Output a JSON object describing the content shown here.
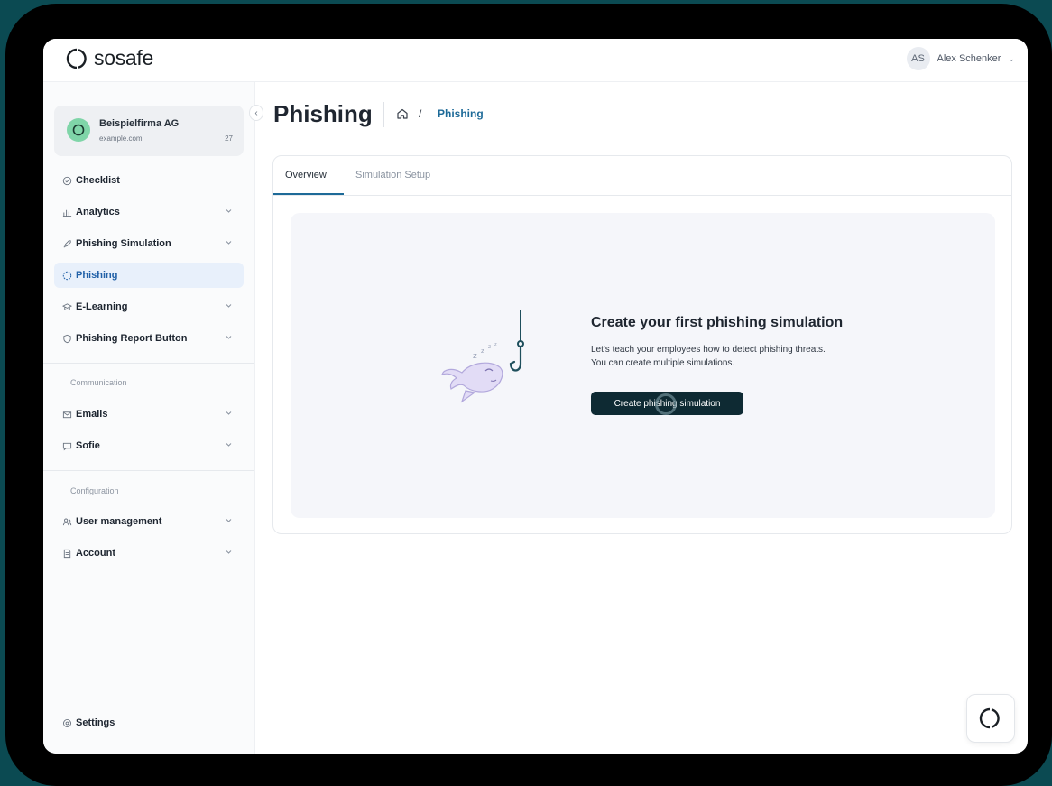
{
  "brand": {
    "name": "sosafe"
  },
  "user": {
    "initials": "AS",
    "name": "Alex Schenker"
  },
  "org": {
    "name": "Beispielfirma AG",
    "domain": "example.com",
    "count": "27"
  },
  "sidebar": {
    "items": [
      {
        "label": "Checklist",
        "icon": "check-circle-icon"
      },
      {
        "label": "Analytics",
        "icon": "bar-chart-icon"
      },
      {
        "label": "Phishing Simulation",
        "icon": "rocket-icon"
      },
      {
        "label": "Phishing",
        "icon": "hook-icon"
      },
      {
        "label": "E-Learning",
        "icon": "graduation-cap-icon"
      },
      {
        "label": "Phishing Report Button",
        "icon": "shield-icon"
      }
    ],
    "communication_label": "Communication",
    "communication": [
      {
        "label": "Emails",
        "icon": "mail-icon"
      },
      {
        "label": "Sofie",
        "icon": "chat-icon"
      }
    ],
    "configuration_label": "Configuration",
    "configuration": [
      {
        "label": "User management",
        "icon": "users-icon"
      },
      {
        "label": "Account",
        "icon": "document-icon"
      }
    ],
    "settings_label": "Settings"
  },
  "page": {
    "title": "Phishing",
    "breadcrumb_separator": "/",
    "breadcrumb_current": "Phishing"
  },
  "tabs": [
    {
      "label": "Overview",
      "active": true
    },
    {
      "label": "Simulation Setup",
      "active": false
    }
  ],
  "empty_state": {
    "title": "Create your first phishing simulation",
    "desc_line1": "Let's teach your employees how to detect phishing threats.",
    "desc_line2": "You can create multiple simulations.",
    "cta_label": "Create phishing simulation"
  },
  "colors": {
    "accent": "#1d6a98",
    "cta_bg": "#0e2a33",
    "active_bg": "#e8f0fb",
    "org_icon": "#7fd5a8"
  }
}
